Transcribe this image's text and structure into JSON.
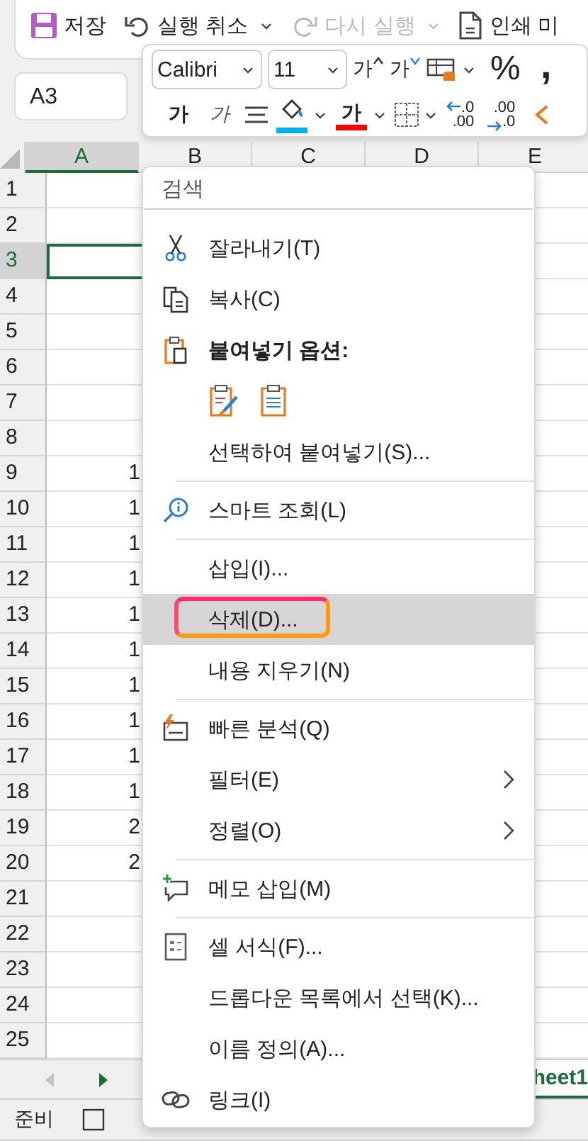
{
  "quick_access": [
    {
      "label": "저장",
      "dropdown": false,
      "disabled": false
    },
    {
      "label": "실행 취소",
      "dropdown": true,
      "disabled": false
    },
    {
      "label": "다시 실행",
      "dropdown": true,
      "disabled": true
    },
    {
      "label": "인쇄 미",
      "dropdown": false,
      "disabled": false
    }
  ],
  "name_box": "A3",
  "mini_toolbar": {
    "font": "Calibri",
    "size": "11",
    "row1": [
      {
        "kind": "grow",
        "label": "가",
        "dropdown": false
      },
      {
        "kind": "shrink",
        "label": "가",
        "dropdown": false
      },
      {
        "kind": "cellstyle",
        "dropdown": true
      },
      {
        "kind": "percent",
        "label": "%",
        "dropdown": false
      },
      {
        "kind": "comma",
        "label": ",",
        "dropdown": false
      }
    ],
    "row2": [
      {
        "kind": "bold",
        "label": "가",
        "dropdown": false
      },
      {
        "kind": "italic",
        "label": "가",
        "dropdown": false
      },
      {
        "kind": "align",
        "dropdown": false
      },
      {
        "kind": "fill",
        "color": "#00b0f0",
        "dropdown": true
      },
      {
        "kind": "fontcolor",
        "label": "가",
        "color": "#ff0000",
        "dropdown": true
      },
      {
        "kind": "borders",
        "dropdown": true
      },
      {
        "kind": "incdec",
        "top": ".0",
        "bottom": ".00",
        "dropdown": false
      },
      {
        "kind": "decdec",
        "top": ".00",
        "bottom": ".0",
        "dropdown": false
      },
      {
        "kind": "partial",
        "dropdown": false
      }
    ]
  },
  "columns": [
    {
      "label": "A",
      "selected": true
    },
    {
      "label": "B",
      "selected": false
    },
    {
      "label": "C",
      "selected": false
    },
    {
      "label": "D",
      "selected": false
    },
    {
      "label": "E",
      "selected": false
    }
  ],
  "rows": [
    {
      "label": "1",
      "selected": false
    },
    {
      "label": "2",
      "selected": false
    },
    {
      "label": "3",
      "selected": true
    },
    {
      "label": "4",
      "selected": false
    },
    {
      "label": "5",
      "selected": false
    },
    {
      "label": "6",
      "selected": false
    },
    {
      "label": "7",
      "selected": false
    },
    {
      "label": "8",
      "selected": false
    },
    {
      "label": "9",
      "selected": false,
      "value": "1"
    },
    {
      "label": "10",
      "selected": false,
      "value": "1"
    },
    {
      "label": "11",
      "selected": false,
      "value": "1"
    },
    {
      "label": "12",
      "selected": false,
      "value": "1"
    },
    {
      "label": "13",
      "selected": false,
      "value": "1"
    },
    {
      "label": "14",
      "selected": false,
      "value": "1"
    },
    {
      "label": "15",
      "selected": false,
      "value": "1"
    },
    {
      "label": "16",
      "selected": false,
      "value": "1"
    },
    {
      "label": "17",
      "selected": false,
      "value": "1"
    },
    {
      "label": "18",
      "selected": false,
      "value": "1"
    },
    {
      "label": "19",
      "selected": false,
      "value": "2"
    },
    {
      "label": "20",
      "selected": false,
      "value": "2"
    },
    {
      "label": "21",
      "selected": false
    },
    {
      "label": "22",
      "selected": false
    },
    {
      "label": "23",
      "selected": false
    },
    {
      "label": "24",
      "selected": false
    },
    {
      "label": "25",
      "selected": false
    }
  ],
  "sheet_nav": [
    {
      "kind": "prev",
      "disabled": true
    },
    {
      "kind": "next",
      "disabled": false
    }
  ],
  "sheet_tab": {
    "label": "heet1",
    "selected": true
  },
  "status_bar": {
    "text": "준비"
  },
  "context_menu": {
    "search_placeholder": "검색",
    "items": [
      {
        "kind": "item",
        "label": "잘라내기(T)",
        "highlighted": false,
        "outlined": false,
        "submenu": false
      },
      {
        "kind": "item",
        "label": "복사(C)",
        "highlighted": false,
        "outlined": false,
        "submenu": false
      },
      {
        "kind": "header",
        "label": "붙여넣기 옵션:"
      },
      {
        "kind": "paste-options"
      },
      {
        "kind": "item",
        "label": "선택하여 붙여넣기(S)...",
        "highlighted": false,
        "outlined": false,
        "submenu": false
      },
      {
        "kind": "separator"
      },
      {
        "kind": "item",
        "label": "스마트 조회(L)",
        "highlighted": false,
        "outlined": false,
        "submenu": false
      },
      {
        "kind": "separator"
      },
      {
        "kind": "item",
        "label": "삽입(I)...",
        "highlighted": false,
        "outlined": false,
        "submenu": false
      },
      {
        "kind": "item",
        "label": "삭제(D)...",
        "highlighted": true,
        "outlined": true,
        "submenu": false
      },
      {
        "kind": "item",
        "label": "내용 지우기(N)",
        "highlighted": false,
        "outlined": false,
        "submenu": false
      },
      {
        "kind": "separator"
      },
      {
        "kind": "item",
        "label": "빠른 분석(Q)",
        "highlighted": false,
        "outlined": false,
        "submenu": false
      },
      {
        "kind": "item",
        "label": "필터(E)",
        "highlighted": false,
        "outlined": false,
        "submenu": true
      },
      {
        "kind": "item",
        "label": "정렬(O)",
        "highlighted": false,
        "outlined": false,
        "submenu": true
      },
      {
        "kind": "separator"
      },
      {
        "kind": "item",
        "label": "메모 삽입(M)",
        "highlighted": false,
        "outlined": false,
        "submenu": false
      },
      {
        "kind": "separator"
      },
      {
        "kind": "item",
        "label": "셀 서식(F)...",
        "highlighted": false,
        "outlined": false,
        "submenu": false
      },
      {
        "kind": "item",
        "label": "드롭다운 목록에서 선택(K)...",
        "highlighted": false,
        "outlined": false,
        "submenu": false
      },
      {
        "kind": "item",
        "label": "이름 정의(A)...",
        "highlighted": false,
        "outlined": false,
        "submenu": false
      },
      {
        "kind": "item",
        "label": "링크(I)",
        "highlighted": false,
        "outlined": false,
        "submenu": false
      }
    ]
  }
}
